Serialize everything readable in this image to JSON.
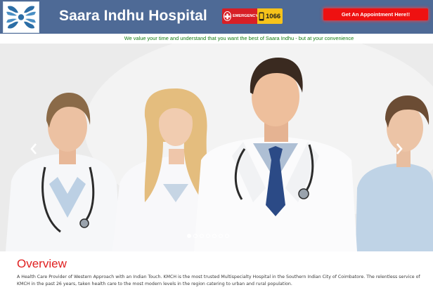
{
  "header": {
    "site_title": "Saara Indhu Hospital",
    "logo_icon": "hands-circle-logo-icon",
    "emergency": {
      "label": "EMERGENCY",
      "number": "1066",
      "icon": "emergency-cross-icon",
      "phone_icon": "phone-icon"
    },
    "appointment_button": "Get An Appointment Here!!",
    "colors": {
      "header_bg": "#4e6a96",
      "button_red": "#ee1111",
      "emergency_red": "#d71f26",
      "emergency_yellow": "#f7c31a"
    }
  },
  "tagline": "We value your time and understand that you want the best of Saara Indhu - but at your convenience",
  "carousel": {
    "prev_icon": "chevron-left-icon",
    "next_icon": "chevron-right-icon",
    "indicator_count": 7,
    "active_index": 0
  },
  "overview": {
    "title": "Overview",
    "text": "A Health Care Provider of Western Approach with an Indian Touch. KMCH is the most trusted Multispecialty Hospital in the Southern Indian City of Coimbatore. The relentless service of KMCH in the past 26 years, taken health care to the most modern levels in the region catering to urban and rural population."
  }
}
